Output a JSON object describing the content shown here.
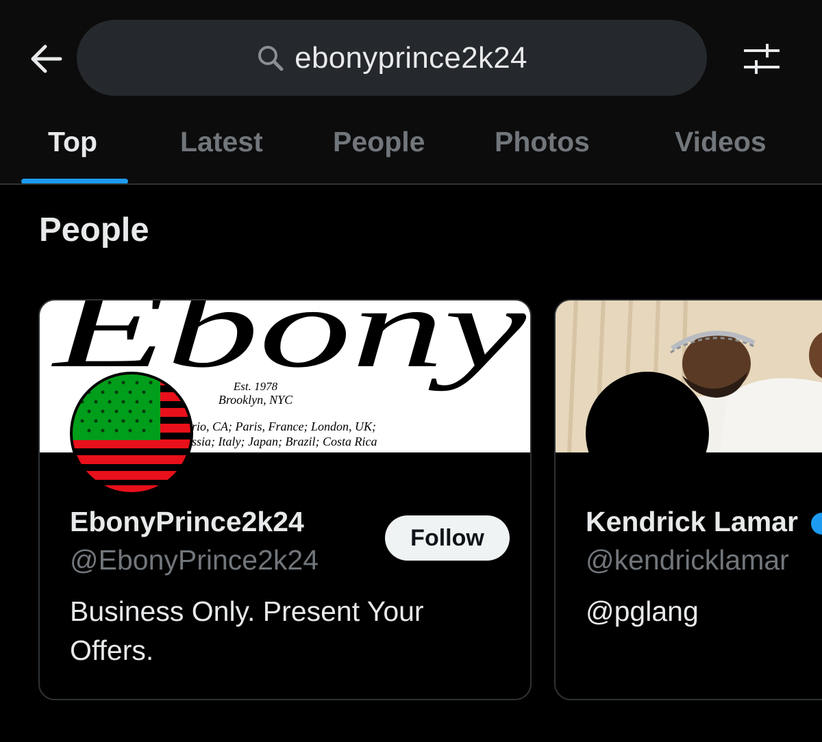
{
  "search": {
    "query": "ebonyprince2k24"
  },
  "icons": {
    "back": "back-arrow-icon",
    "search": "search-icon",
    "filter": "filter-sliders-icon",
    "verified": "verified-badge-icon"
  },
  "tabs": [
    {
      "label": "Top",
      "active": true
    },
    {
      "label": "Latest",
      "active": false
    },
    {
      "label": "People",
      "active": false
    },
    {
      "label": "Photos",
      "active": false
    },
    {
      "label": "Videos",
      "active": false
    }
  ],
  "section_title": "People",
  "people": [
    {
      "display_name": "EbonyPrince2k24",
      "handle": "@EbonyPrince2k24",
      "bio": "Business Only. Present Your Offers.",
      "follow_label": "Follow",
      "banner_text": {
        "wordmark": "Ebony",
        "line1": "Est. 1978",
        "line2": "Brooklyn, NYC",
        "line3": "rio, CA; Paris, France; London, UK;",
        "line4": "ssia; Italy; Japan; Brazil; Costa Rica"
      }
    },
    {
      "display_name": "Kendrick Lamar",
      "handle": "@kendricklamar",
      "bio": "@pglang"
    }
  ],
  "colors": {
    "accent": "#1d9bf0",
    "flag_green": "#009e1a",
    "flag_red": "#e8101a",
    "muted": "#71767b"
  }
}
